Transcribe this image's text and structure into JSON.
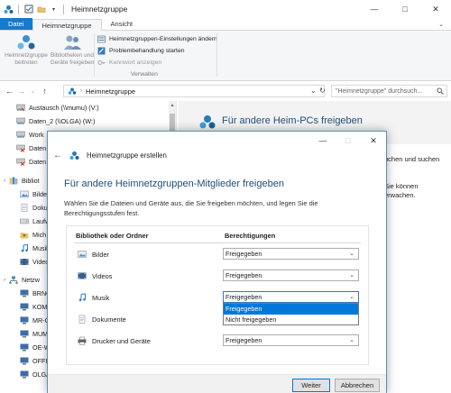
{
  "window": {
    "title": "Heimnetzgruppe",
    "controls": {
      "minimize": "—",
      "maximize": "□",
      "close": "✕"
    }
  },
  "ribbon": {
    "tabs": [
      "Datei",
      "Heimnetzgruppe",
      "Ansicht"
    ],
    "big_buttons": [
      {
        "label_line1": "Heimnetzgruppe",
        "label_line2": "beitreten"
      },
      {
        "label_line1": "Bibliotheken und",
        "label_line2": "Geräte freigeben"
      }
    ],
    "small_buttons": [
      "Heimnetzgruppen-Einstellungen ändern",
      "Problembehandlung starten",
      "Kennwort anzeigen"
    ],
    "group_label": "Verwalten"
  },
  "address": {
    "path": "Heimnetzgruppe",
    "search_placeholder": "\"Heimnetzgruppe\" durchsuch..."
  },
  "navpane": {
    "items": [
      "Austausch (\\\\mumu) (V:)",
      "Daten_2 (\\\\OLGA) (W:)",
      "Work",
      "Daten",
      "Daten",
      "Bibliot",
      "Bilde",
      "Doku",
      "Laufw",
      "Mich",
      "Musik",
      "Video",
      "Netzw",
      "BRNO",
      "KOM",
      "MR-O",
      "MUM",
      "OE-W",
      "OFFIC",
      "OLGA"
    ]
  },
  "content": {
    "banner_title": "Für andere Heim-PCs freigeben",
    "bg_text_1": "uchen und suchen",
    "bg_text_2a": "Sie können",
    "bg_text_2b": "erwachen."
  },
  "dialog": {
    "title": "Heimnetzgruppe erstellen",
    "heading": "Für andere Heimnetzgruppen-Mitglieder freigeben",
    "description": "Wählen Sie die Dateien und Geräte aus, die Sie freigeben möchten, und legen Sie die Berechtigungsstufen fest.",
    "col_library": "Bibliothek oder Ordner",
    "col_permissions": "Berechtigungen",
    "rows": [
      {
        "label": "Bilder",
        "value": "Freigegeben"
      },
      {
        "label": "Videos",
        "value": "Freigegeben"
      },
      {
        "label": "Musik",
        "value": "Freigegeben"
      },
      {
        "label": "Dokumente",
        "value": ""
      },
      {
        "label": "Drucker und Geräte",
        "value": "Freigegeben"
      }
    ],
    "dropdown_options": [
      "Freigegeben",
      "Nicht freigegeben"
    ],
    "button_next": "Weiter",
    "button_cancel": "Abbrechen"
  },
  "colors": {
    "accent": "#0078d7",
    "file_tab": "#1979ca",
    "heading": "#1e4e79"
  }
}
